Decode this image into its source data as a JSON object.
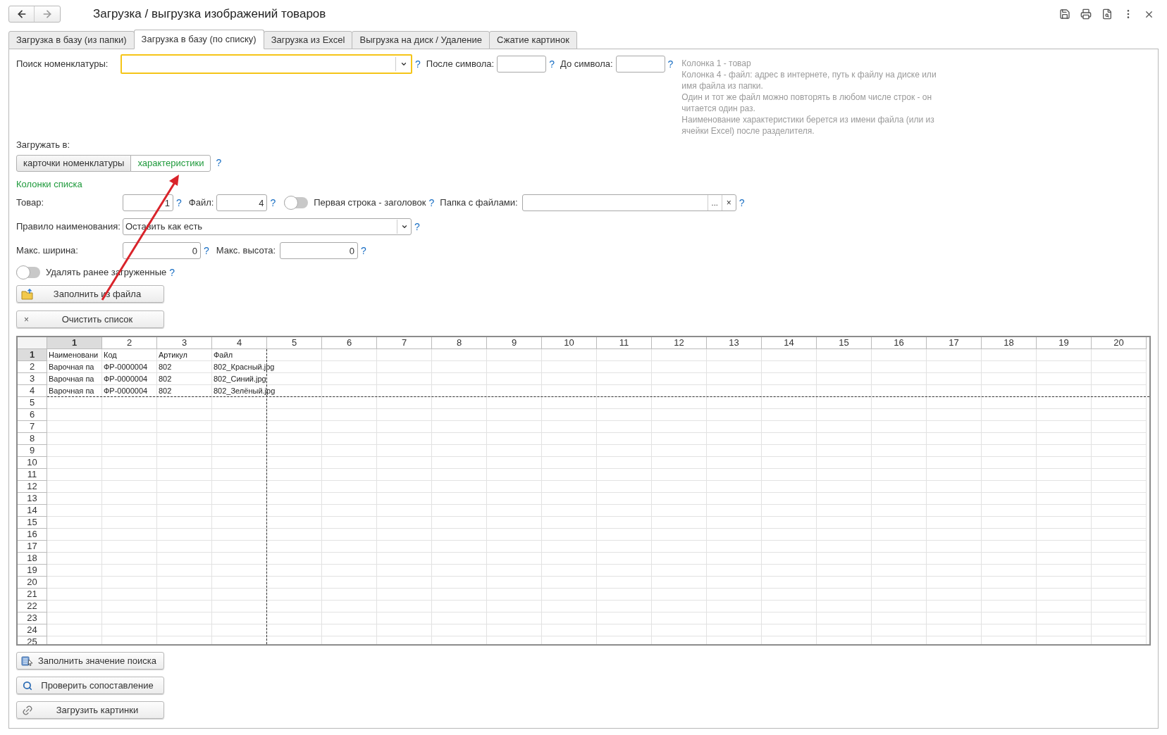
{
  "window": {
    "title": "Загрузка / выгрузка изображений товаров"
  },
  "tabs": [
    {
      "label": "Загрузка в базу (из папки)",
      "selected": false
    },
    {
      "label": "Загрузка в базу (по списку)",
      "selected": true
    },
    {
      "label": "Загрузка из Excel",
      "selected": false
    },
    {
      "label": "Выгрузка на диск / Удаление",
      "selected": false
    },
    {
      "label": "Сжатие картинок",
      "selected": false
    }
  ],
  "search": {
    "label": "Поиск номенклатуры:",
    "help": "?",
    "after_label": "После символа:",
    "after_help": "?",
    "before_label": "До символа:",
    "before_help": "?"
  },
  "hint": [
    "Колонка 1 - товар",
    "Колонка 4 - файл: адрес в интернете, путь к файлу на диске или имя файла из папки.",
    "Один и тот же файл можно повторять в любом числе строк - он читается один раз.",
    "Наименование характеристики берется из имени файла (или из ячейки Excel) после разделителя."
  ],
  "load_into": {
    "label": "Загружать в:",
    "options": [
      {
        "label": "карточки номенклатуры",
        "selected": false
      },
      {
        "label": "характеристики",
        "selected": true
      }
    ],
    "help": "?"
  },
  "columns_section": {
    "title": "Колонки списка"
  },
  "product_col": {
    "label": "Товар:",
    "value": "1",
    "help": "?"
  },
  "file_col": {
    "label": "Файл:",
    "value": "4",
    "help": "?"
  },
  "first_row_header": {
    "label": "Первая строка - заголовок",
    "on": false,
    "help": "?"
  },
  "folder": {
    "label": "Папка с файлами:",
    "browse": "...",
    "clear": "×",
    "help": "?"
  },
  "naming_rule": {
    "label": "Правило наименования:",
    "value": "Оставить как есть",
    "help": "?"
  },
  "max_width": {
    "label": "Макс. ширина:",
    "value": "0",
    "help": "?"
  },
  "max_height": {
    "label": "Макс. высота:",
    "value": "0",
    "help": "?"
  },
  "delete_previous": {
    "label": "Удалять ранее загруженные",
    "on": false,
    "help": "?"
  },
  "top_buttons": [
    {
      "kind": "folder",
      "label": "Заполнить из файла"
    },
    {
      "kind": "clear",
      "label": "Очистить список",
      "glyph": "×"
    }
  ],
  "sheet": {
    "columns": [
      {
        "label": "1",
        "selected": true
      },
      {
        "label": "2",
        "selected": false
      },
      {
        "label": "3",
        "selected": false
      },
      {
        "label": "4",
        "selected": false
      },
      {
        "label": "5",
        "selected": false
      },
      {
        "label": "6",
        "selected": false
      },
      {
        "label": "7",
        "selected": false
      },
      {
        "label": "8",
        "selected": false
      },
      {
        "label": "9",
        "selected": false
      },
      {
        "label": "10",
        "selected": false
      },
      {
        "label": "11",
        "selected": false
      },
      {
        "label": "12",
        "selected": false
      },
      {
        "label": "13",
        "selected": false
      },
      {
        "label": "14",
        "selected": false
      },
      {
        "label": "15",
        "selected": false
      },
      {
        "label": "16",
        "selected": false
      },
      {
        "label": "17",
        "selected": false
      },
      {
        "label": "18",
        "selected": false
      },
      {
        "label": "19",
        "selected": false
      },
      {
        "label": "20",
        "selected": false
      }
    ],
    "rows": [
      {
        "number": "1",
        "selected": true,
        "cells": [
          "Наименовани",
          "Код",
          "Артикул",
          "Файл"
        ]
      },
      {
        "number": "2",
        "selected": false,
        "cells": [
          "Варочная па",
          "ФР-0000004",
          "802",
          "802_Красный.jpg"
        ]
      },
      {
        "number": "3",
        "selected": false,
        "cells": [
          "Варочная па",
          "ФР-0000004",
          "802",
          "802_Синий.jpg"
        ]
      },
      {
        "number": "4",
        "selected": false,
        "cells": [
          "Варочная па",
          "ФР-0000004",
          "802",
          "802_Зелёный.jpg"
        ]
      },
      {
        "number": "5",
        "selected": false,
        "cells": []
      },
      {
        "number": "6",
        "selected": false,
        "cells": []
      },
      {
        "number": "7",
        "selected": false,
        "cells": []
      },
      {
        "number": "8",
        "selected": false,
        "cells": []
      },
      {
        "number": "9",
        "selected": false,
        "cells": []
      },
      {
        "number": "10",
        "selected": false,
        "cells": []
      },
      {
        "number": "11",
        "selected": false,
        "cells": []
      },
      {
        "number": "12",
        "selected": false,
        "cells": []
      },
      {
        "number": "13",
        "selected": false,
        "cells": []
      },
      {
        "number": "14",
        "selected": false,
        "cells": []
      },
      {
        "number": "15",
        "selected": false,
        "cells": []
      },
      {
        "number": "16",
        "selected": false,
        "cells": []
      },
      {
        "number": "17",
        "selected": false,
        "cells": []
      },
      {
        "number": "18",
        "selected": false,
        "cells": []
      },
      {
        "number": "19",
        "selected": false,
        "cells": []
      },
      {
        "number": "20",
        "selected": false,
        "cells": []
      },
      {
        "number": "21",
        "selected": false,
        "cells": []
      },
      {
        "number": "22",
        "selected": false,
        "cells": []
      },
      {
        "number": "23",
        "selected": false,
        "cells": []
      },
      {
        "number": "24",
        "selected": false,
        "cells": []
      },
      {
        "number": "25",
        "selected": false,
        "cells": []
      }
    ]
  },
  "bottom_buttons": [
    {
      "kind": "fill",
      "label": "Заполнить значение поиска"
    },
    {
      "kind": "search",
      "label": "Проверить сопоставление"
    },
    {
      "kind": "link",
      "label": "Загрузить картинки"
    }
  ]
}
